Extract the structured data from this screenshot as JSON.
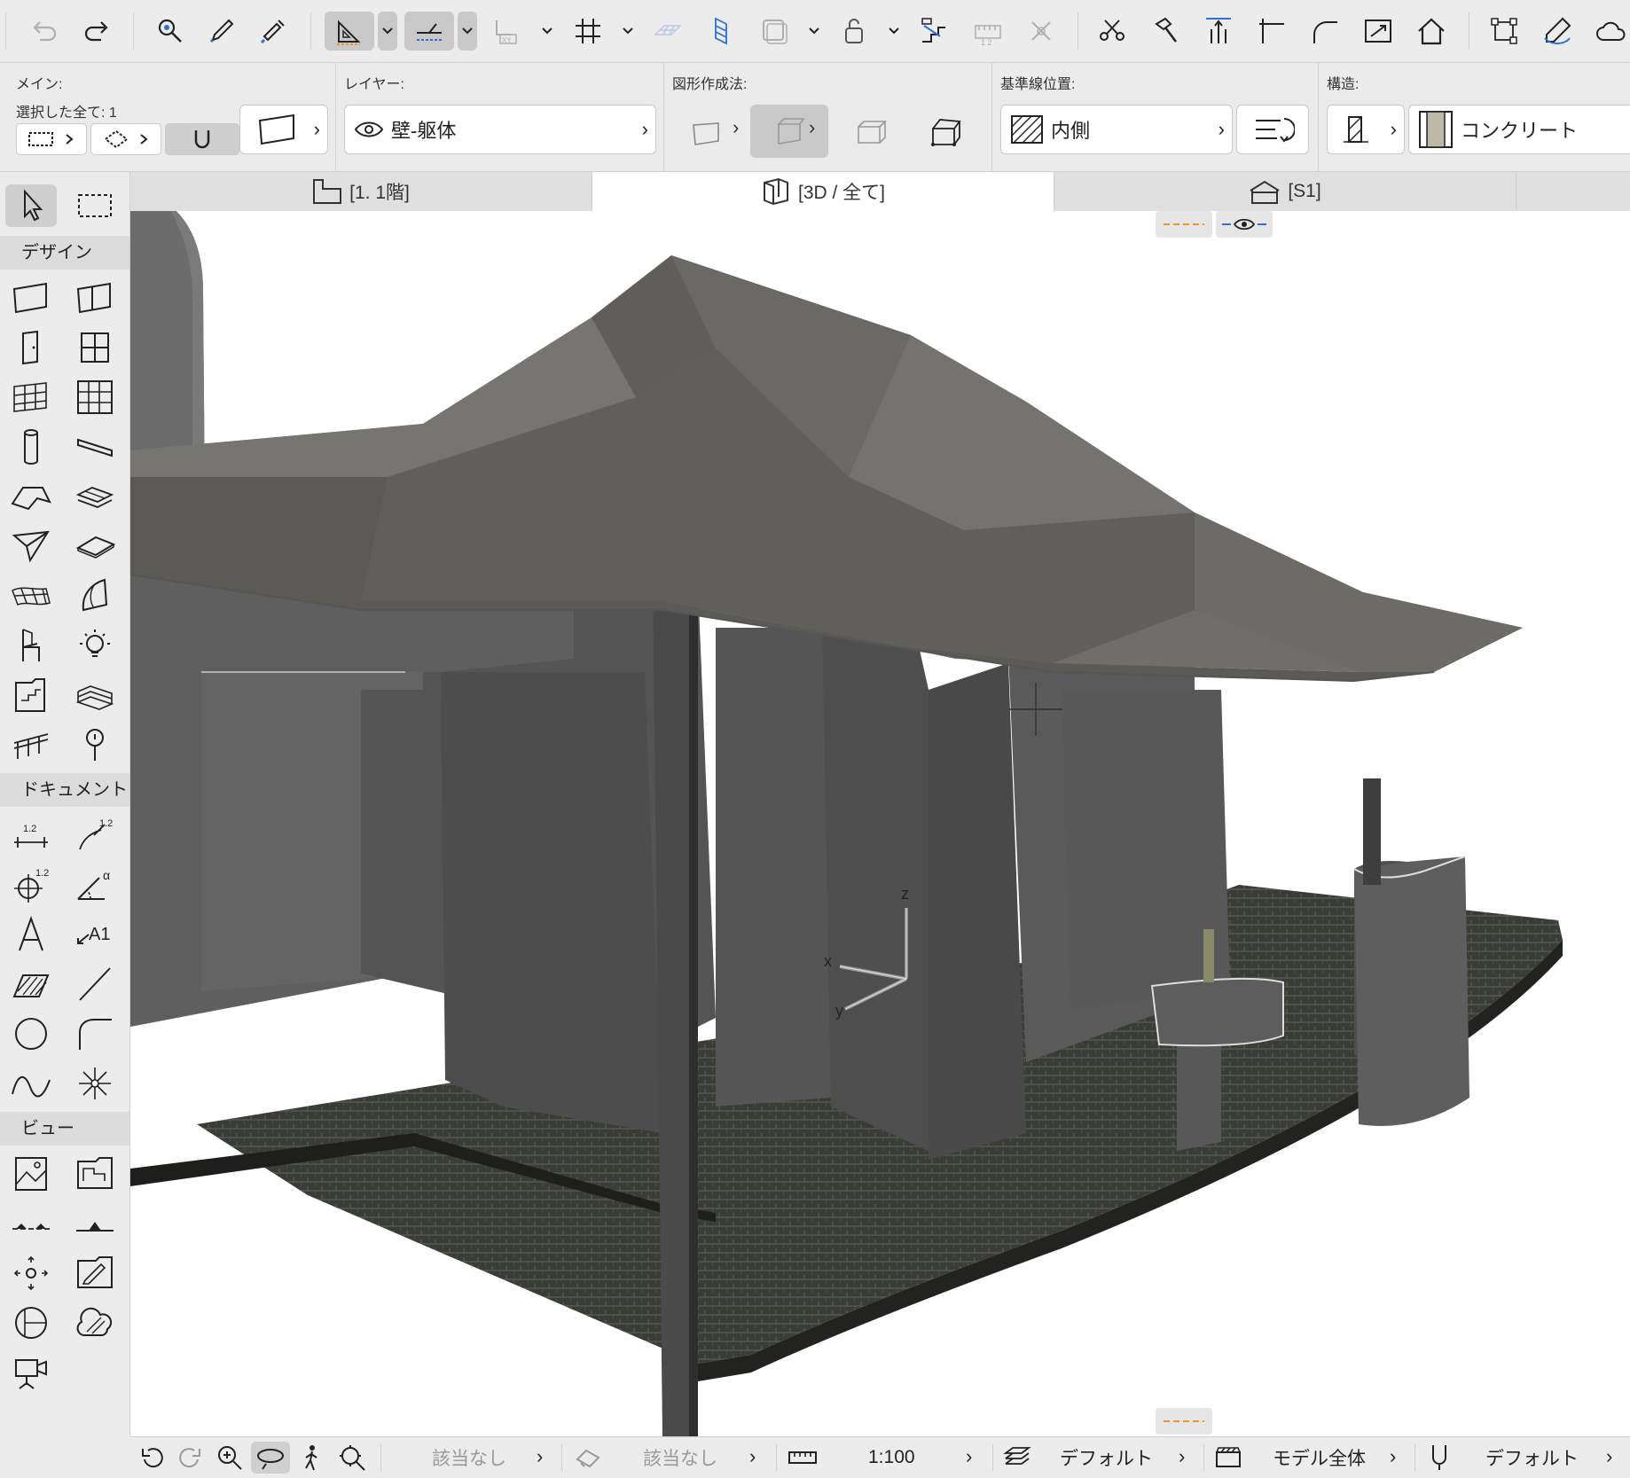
{
  "infobox": {
    "main_title": "メイン:",
    "selection_label": "選択した全て: 1",
    "layer_title": "レイヤー:",
    "layer_value": "壁-躯体",
    "geometry_title": "図形作成法:",
    "refline_title": "基準線位置:",
    "refline_value": "内側",
    "structure_title": "構造:",
    "structure_value": "コンクリート"
  },
  "tabs": [
    {
      "label": "[1. 1階]",
      "icon": "floorplan-icon"
    },
    {
      "label": "[3D / 全て]",
      "icon": "3d-icon"
    },
    {
      "label": "[S1]",
      "icon": "section-icon"
    }
  ],
  "toolbox": {
    "design": "デザイン",
    "document": "ドキュメント",
    "view": "ビュー"
  },
  "statusbar": {
    "undo_view": "該当なし",
    "zoom_view": "該当なし",
    "scale": "1:100",
    "layer_combo": "デフォルト",
    "model_view": "モデル全体",
    "pen_set": "デフォルト"
  },
  "viewport": {
    "axis_x": "x",
    "axis_y": "y",
    "axis_z": "z"
  },
  "colors": {
    "accent_orange": "#f0932b",
    "accent_blue": "#2f6fd6",
    "wall": "#5b5b5b",
    "roof": "#6b6a67"
  }
}
